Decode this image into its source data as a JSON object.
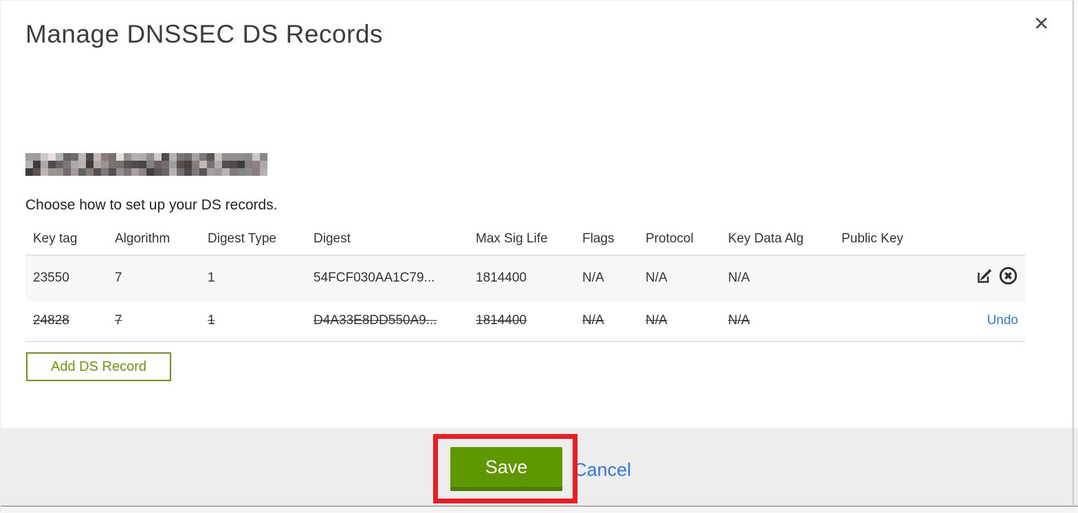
{
  "window": {
    "close_icon": "✕"
  },
  "modal": {
    "title": "Manage DNSSEC DS Records",
    "domain_redacted": true,
    "instruction": "Choose how to set up your DS records."
  },
  "table": {
    "columns": [
      "Key tag",
      "Algorithm",
      "Digest Type",
      "Digest",
      "Max Sig Life",
      "Flags",
      "Protocol",
      "Key Data Alg",
      "Public Key"
    ],
    "rows": [
      {
        "key_tag": "23550",
        "algorithm": "7",
        "digest_type": "1",
        "digest": "54FCF030AA1C79...",
        "max_sig_life": "1814400",
        "flags": "N/A",
        "protocol": "N/A",
        "key_data_alg": "N/A",
        "public_key": "",
        "state": "normal",
        "actions": [
          "edit",
          "delete"
        ]
      },
      {
        "key_tag": "24828",
        "algorithm": "7",
        "digest_type": "1",
        "digest": "D4A33E8DD550A9...",
        "max_sig_life": "1814400",
        "flags": "N/A",
        "protocol": "N/A",
        "key_data_alg": "N/A",
        "public_key": "",
        "state": "deleted",
        "undo_label": "Undo"
      }
    ]
  },
  "buttons": {
    "add_ds_record": "Add DS Record",
    "save": "Save",
    "cancel": "Cancel"
  },
  "colors": {
    "accent_green": "#5e9700",
    "accent_green_dark": "#4c7c00",
    "outline_green": "#6b9a07",
    "link_blue": "#2f7ae5",
    "annotation_red": "#ec1c20",
    "row_alt_bg": "#f7f7f7",
    "footer_bg": "#ededed"
  }
}
